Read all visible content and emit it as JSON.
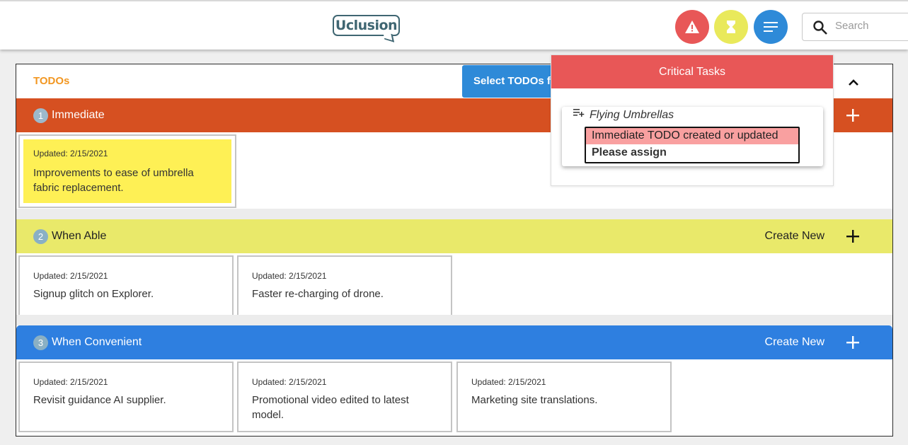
{
  "header": {
    "logo_text": "Uclusion",
    "search_placeholder": "Search"
  },
  "todos": {
    "title": "TODOs",
    "select_button": "Select TODOs for",
    "sections": [
      {
        "number": "1",
        "label": "Immediate",
        "create_label": "",
        "color": "#d65021",
        "cards": [
          {
            "updated": "Updated: 2/15/2021",
            "text": "Improvements to ease of umbrella fabric replacement."
          }
        ]
      },
      {
        "number": "2",
        "label": "When Able",
        "create_label": "Create New",
        "color": "#e9e96a",
        "cards": [
          {
            "updated": "Updated: 2/15/2021",
            "text": "Signup glitch on Explorer."
          },
          {
            "updated": "Updated: 2/15/2021",
            "text": "Faster re-charging of drone."
          }
        ]
      },
      {
        "number": "3",
        "label": "When Convenient",
        "create_label": "Create New",
        "color": "#2e7fe0",
        "cards": [
          {
            "updated": "Updated: 2/15/2021",
            "text": "Revisit guidance AI supplier."
          },
          {
            "updated": "Updated: 2/15/2021",
            "text": "Promotional video edited to latest model."
          },
          {
            "updated": "Updated: 2/15/2021",
            "text": "Marketing site translations."
          }
        ]
      }
    ]
  },
  "critical_popup": {
    "title": "Critical Tasks",
    "market_name": "Flying Umbrellas",
    "alert_line1": "Immediate TODO created or updated",
    "alert_line2": "Please assign"
  },
  "icons": {
    "warning": "warning-icon",
    "hourglass": "hourglass-icon",
    "menu": "menu-icon",
    "search": "search-icon",
    "collapse": "chevron-up-icon",
    "add": "plus-icon",
    "playlist": "playlist-add-icon"
  },
  "colors": {
    "accent_orange": "#f29722",
    "critical_red": "#e85757",
    "highlight_yellow": "#fef055",
    "primary_blue": "#2e8ad8"
  }
}
